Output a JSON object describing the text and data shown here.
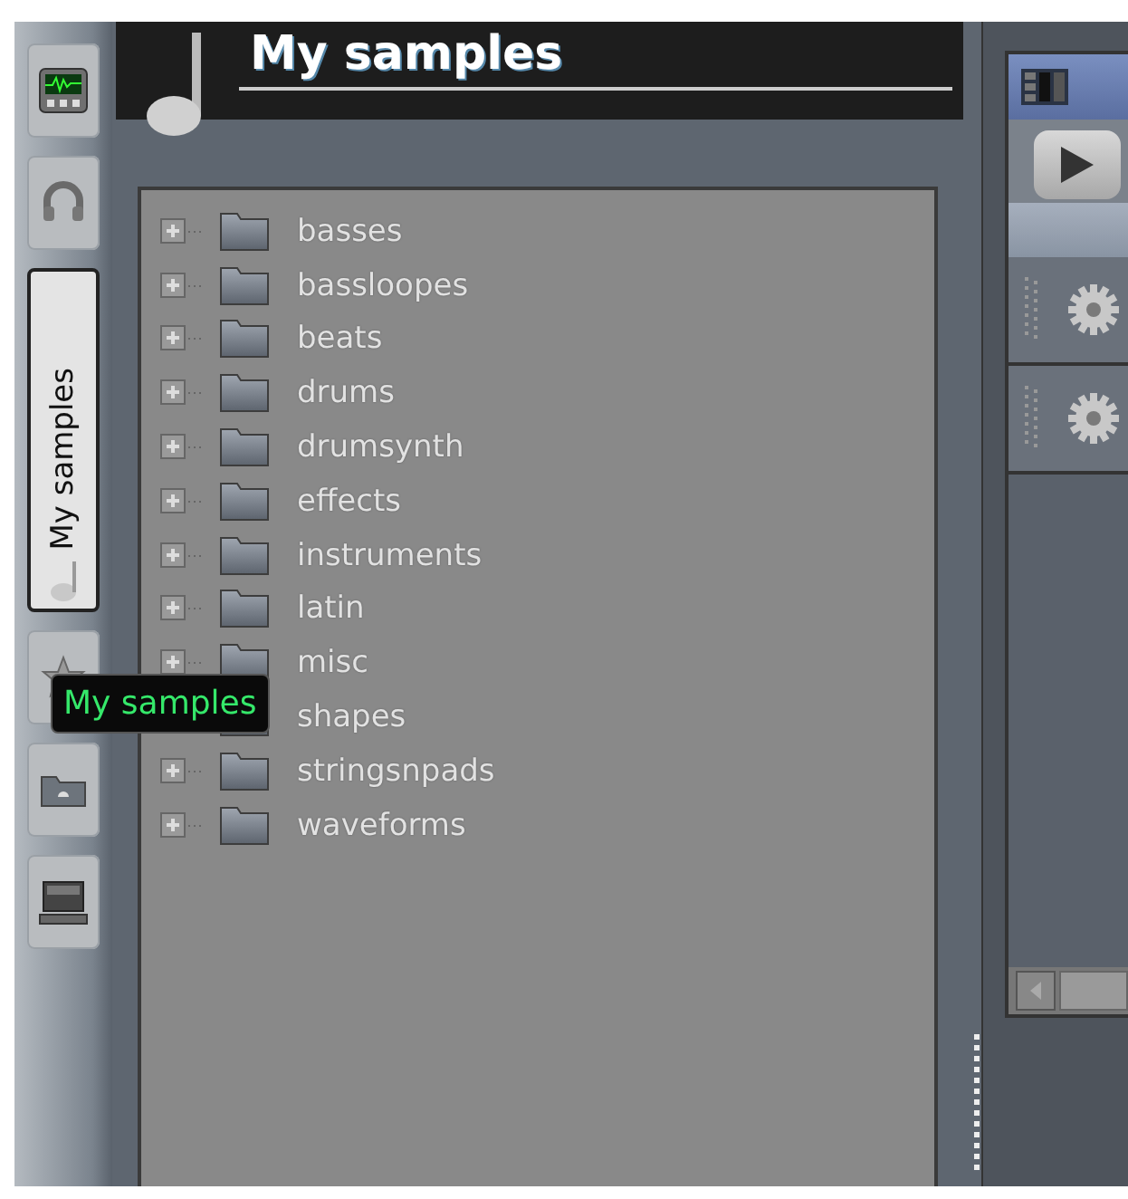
{
  "sidebar": {
    "tabs": [
      {
        "kind": "instrument",
        "selected": false
      },
      {
        "kind": "plugin",
        "selected": false
      },
      {
        "kind": "samples",
        "label": "My samples",
        "selected": true
      },
      {
        "kind": "favorites",
        "selected": false
      },
      {
        "kind": "folder",
        "selected": false
      },
      {
        "kind": "computer",
        "selected": false
      }
    ]
  },
  "tooltip": "My samples",
  "browser": {
    "title": "My samples",
    "tree": [
      {
        "label": "basses",
        "expanded": false
      },
      {
        "label": "bassloopes",
        "expanded": false
      },
      {
        "label": "beats",
        "expanded": false
      },
      {
        "label": "drums",
        "expanded": false
      },
      {
        "label": "drumsynth",
        "expanded": false
      },
      {
        "label": "effects",
        "expanded": false
      },
      {
        "label": "instruments",
        "expanded": false
      },
      {
        "label": "latin",
        "expanded": false
      },
      {
        "label": "misc",
        "expanded": false
      },
      {
        "label": "shapes"
      },
      {
        "label": "stringsnpads",
        "expanded": false
      },
      {
        "label": "waveforms",
        "expanded": false
      }
    ]
  },
  "mixer": {
    "channels": [
      {
        "kind": "gear"
      },
      {
        "kind": "gear"
      }
    ]
  }
}
